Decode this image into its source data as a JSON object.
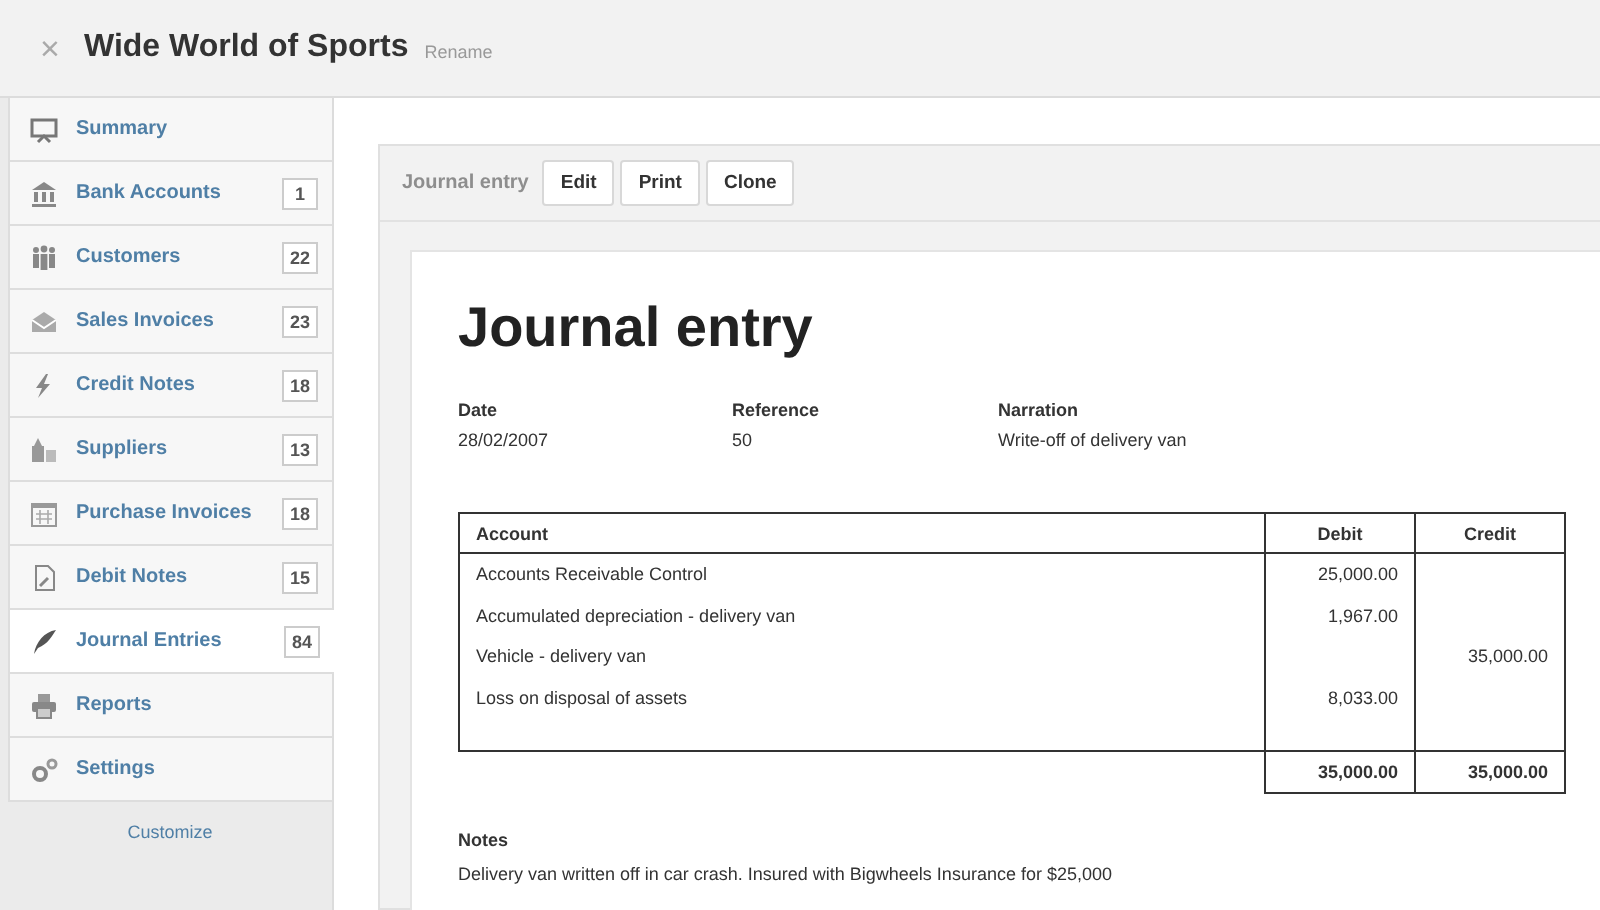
{
  "header": {
    "close": "×",
    "title": "Wide World of Sports",
    "rename": "Rename"
  },
  "sidebar": {
    "items": [
      {
        "label": "Summary",
        "selected": false
      },
      {
        "label": "Bank Accounts",
        "count": "1",
        "selected": false
      },
      {
        "label": "Customers",
        "count": "22",
        "selected": false
      },
      {
        "label": "Sales Invoices",
        "count": "23",
        "selected": false
      },
      {
        "label": "Credit Notes",
        "count": "18",
        "selected": false
      },
      {
        "label": "Suppliers",
        "count": "13",
        "selected": false
      },
      {
        "label": "Purchase Invoices",
        "count": "18",
        "selected": false
      },
      {
        "label": "Debit Notes",
        "count": "15",
        "selected": false
      },
      {
        "label": "Journal Entries",
        "count": "84",
        "selected": true
      },
      {
        "label": "Reports",
        "selected": false
      },
      {
        "label": "Settings",
        "selected": false
      }
    ],
    "customize": "Customize"
  },
  "toolbar": {
    "breadcrumb": "Journal entry",
    "buttons": [
      "Edit",
      "Print",
      "Clone"
    ]
  },
  "document": {
    "heading": "Journal entry",
    "fields": [
      {
        "label": "Date",
        "value": "28/02/2007"
      },
      {
        "label": "Reference",
        "value": "50"
      },
      {
        "label": "Narration",
        "value": "Write-off of delivery van"
      }
    ],
    "table": {
      "columns": [
        "Account",
        "Debit",
        "Credit"
      ],
      "rows": [
        {
          "account": "Accounts Receivable Control",
          "debit": "25,000.00"
        },
        {
          "account": "Accumulated depreciation - delivery van",
          "debit": "1,967.00"
        },
        {
          "account": "Vehicle - delivery van",
          "credit": "35,000.00"
        },
        {
          "account": "Loss on disposal of assets",
          "debit": "8,033.00"
        }
      ],
      "totals": {
        "debit": "35,000.00",
        "credit": "35,000.00"
      }
    },
    "notes_label": "Notes",
    "notes": "Delivery van written off in car crash. Insured with Bigwheels Insurance for $25,000"
  }
}
